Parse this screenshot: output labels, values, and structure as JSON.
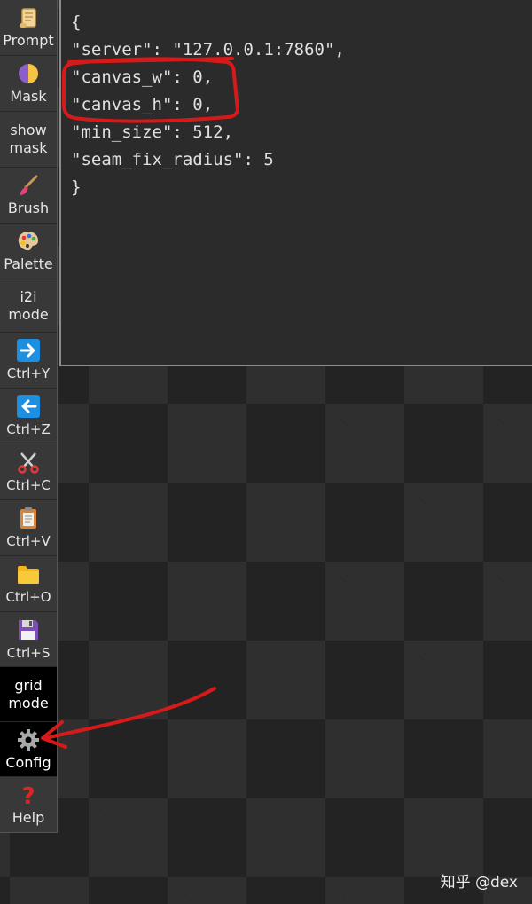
{
  "toolbar": {
    "prompt": "Prompt",
    "mask": "Mask",
    "show_mask_1": "show",
    "show_mask_2": "mask",
    "brush": "Brush",
    "palette": "Palette",
    "i2i_1": "i2i",
    "i2i_2": "mode",
    "redo": "Ctrl+Y",
    "undo": "Ctrl+Z",
    "cut": "Ctrl+C",
    "paste": "Ctrl+V",
    "open": "Ctrl+O",
    "save": "Ctrl+S",
    "grid_1": "grid",
    "grid_2": "mode",
    "config": "Config",
    "help": "Help"
  },
  "icons": {
    "prompt": "scroll-icon",
    "mask": "half-moon-icon",
    "brush": "paintbrush-icon",
    "palette": "palette-icon",
    "redo": "right-arrow-icon",
    "undo": "left-arrow-icon",
    "cut": "scissors-icon",
    "paste": "clipboard-icon",
    "open": "folder-icon",
    "save": "floppy-disk-icon",
    "config": "gear-icon",
    "help": "question-mark-icon"
  },
  "editor": {
    "lines": [
      "{",
      "\"server\": \"127.0.0.1:7860\",",
      "\"canvas_w\": 0,",
      "\"canvas_h\": 0,",
      "\"min_size\": 512,",
      "\"seam_fix_radius\": 5",
      "}"
    ]
  },
  "watermark": "知乎 @dex",
  "colors": {
    "annotation": "#d61a1a",
    "toolbar_bg": "#383838",
    "editor_bg": "#2b2b2b",
    "arrow_button": "#1d8fe0"
  }
}
